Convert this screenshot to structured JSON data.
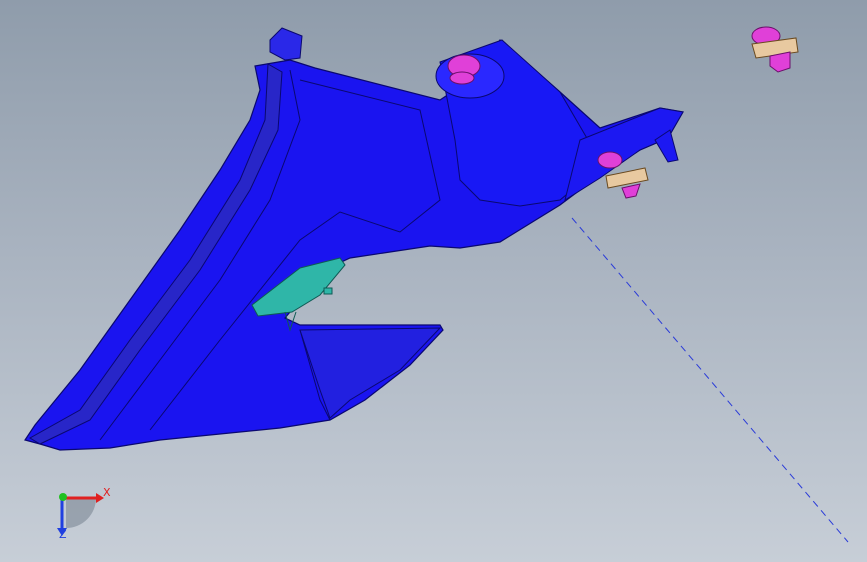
{
  "viewport": {
    "background_top": "#8f9cab",
    "background_bottom": "#c7ced7"
  },
  "part": {
    "main_color": "#1a14f0",
    "edge_color": "#0a0870",
    "highlight_color": "#3b3bff"
  },
  "clip": {
    "color": "#2fb6a8"
  },
  "fasteners": {
    "head_color": "#e040d8",
    "washer_color": "#e8c9a0"
  },
  "centerline": {
    "color": "#2a3bd8",
    "style": "dashed"
  },
  "axis_triad": {
    "x_label": "X",
    "z_label": "Z",
    "x_color": "#e02020",
    "y_color": "#20c020",
    "z_color": "#2040e0",
    "icon": "axis-triad-icon"
  }
}
